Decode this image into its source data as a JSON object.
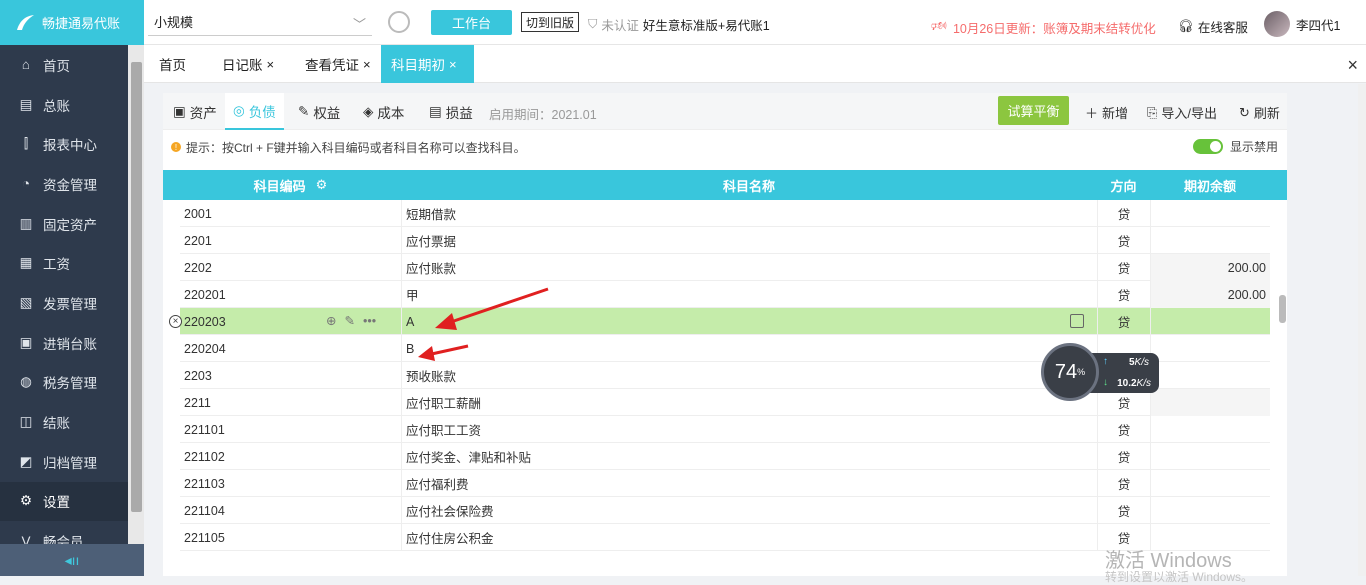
{
  "app": {
    "name": "畅捷通易代账"
  },
  "sidebar": {
    "items": [
      {
        "label": "首页",
        "icon": "home-icon"
      },
      {
        "label": "总账",
        "icon": "ledger-icon"
      },
      {
        "label": "报表中心",
        "icon": "chart-icon"
      },
      {
        "label": "资金管理",
        "icon": "money-icon"
      },
      {
        "label": "固定资产",
        "icon": "asset-icon"
      },
      {
        "label": "工资",
        "icon": "salary-icon"
      },
      {
        "label": "发票管理",
        "icon": "invoice-icon"
      },
      {
        "label": "进销台账",
        "icon": "stock-icon"
      },
      {
        "label": "税务管理",
        "icon": "tax-icon"
      },
      {
        "label": "结账",
        "icon": "close-account-icon"
      },
      {
        "label": "归档管理",
        "icon": "archive-icon"
      },
      {
        "label": "设置",
        "icon": "gear-icon",
        "active": true
      },
      {
        "label": "畅会员",
        "icon": "vip-icon"
      }
    ],
    "collapse_icon": "◂ıı"
  },
  "topbar": {
    "scale_value": "小规模",
    "workbench_label": "工作台",
    "old_version_label": "切到旧版",
    "auth_status": "未认证",
    "company": "好生意标准版+易代账1",
    "notice": "10月26日更新：账簿及期末结转优化",
    "service_label": "在线客服",
    "user_name": "李四代1"
  },
  "tabs": [
    {
      "label": "首页"
    },
    {
      "label": "日记账",
      "close": "×"
    },
    {
      "label": "查看凭证",
      "close": "×"
    },
    {
      "label": "科目期初",
      "close": "×",
      "active": true
    }
  ],
  "tab_close_all": "×",
  "subtabs": {
    "items": [
      {
        "label": "资产"
      },
      {
        "label": "负债",
        "active": true
      },
      {
        "label": "权益"
      },
      {
        "label": "成本"
      },
      {
        "label": "损益"
      }
    ],
    "period": "启用期间：2021.01",
    "trial_balance": "试算平衡",
    "add": "新增",
    "import_export": "导入/导出",
    "refresh": "刷新"
  },
  "tip": {
    "text": "提示：按Ctrl + F键并输入科目编码或者科目名称可以查找科目。",
    "show_disabled": "显示禁用"
  },
  "table": {
    "headers": {
      "code": "科目编码",
      "name": "科目名称",
      "direction": "方向",
      "balance": "期初余额"
    },
    "rows": [
      {
        "code": "2001",
        "name": "短期借款",
        "dir": "贷",
        "bal": ""
      },
      {
        "code": "2201",
        "name": "应付票据",
        "dir": "贷",
        "bal": ""
      },
      {
        "code": "2202",
        "name": "应付账款",
        "dir": "贷",
        "bal": "200.00"
      },
      {
        "code": "220201",
        "name": "甲",
        "dir": "贷",
        "bal": "200.00"
      },
      {
        "code": "220203",
        "name": "A",
        "dir": "贷",
        "bal": ""
      },
      {
        "code": "220204",
        "name": "B",
        "dir": "",
        "bal": ""
      },
      {
        "code": "2203",
        "name": "预收账款",
        "dir": "",
        "bal": ""
      },
      {
        "code": "2211",
        "name": "应付职工薪酬",
        "dir": "贷",
        "bal": ""
      },
      {
        "code": "221101",
        "name": "应付职工工资",
        "dir": "贷",
        "bal": ""
      },
      {
        "code": "221102",
        "name": "应付奖金、津贴和补贴",
        "dir": "贷",
        "bal": ""
      },
      {
        "code": "221103",
        "name": "应付福利费",
        "dir": "贷",
        "bal": ""
      },
      {
        "code": "221104",
        "name": "应付社会保险费",
        "dir": "贷",
        "bal": ""
      },
      {
        "code": "221105",
        "name": "应付住房公积金",
        "dir": "贷",
        "bal": ""
      }
    ]
  },
  "speed_widget": {
    "percent": "74",
    "percent_unit": "%",
    "up": "5",
    "down": "10.2",
    "unit": "K/s"
  },
  "watermark": {
    "title": "激活 Windows",
    "sub": "转到设置以激活 Windows。"
  },
  "colors": {
    "accent": "#39c6dc",
    "sidebar": "#2e3a4c",
    "selected_row": "#c5ecaa",
    "trial": "#8cc63f",
    "notice": "#f56c6c"
  }
}
